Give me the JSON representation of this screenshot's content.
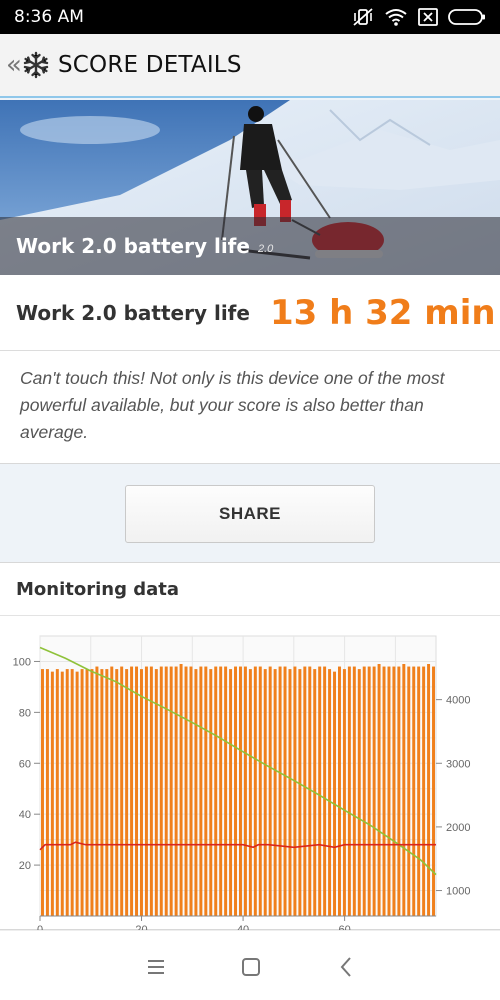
{
  "status_bar": {
    "time": "8:36 AM"
  },
  "app_bar": {
    "back_glyph": "«",
    "title": "SCORE DETAILS",
    "logo_icon": "snowflake-icon"
  },
  "hero": {
    "caption": "Work 2.0 battery life",
    "version": "2.0"
  },
  "score": {
    "label": "Work 2.0 battery life",
    "value": "13 h 32 min",
    "value_color": "#f07d1a"
  },
  "description": "Can't touch this! Not only is this device one of the most powerful available, but your score is also better than average.",
  "share_button": "SHARE",
  "monitoring": {
    "title": "Monitoring data"
  },
  "chart_data": {
    "type": "bar",
    "title": "",
    "xlabel": "",
    "left_axis": {
      "ticks": [
        "100",
        "80",
        "60",
        "40",
        "20"
      ],
      "range": [
        0,
        110
      ]
    },
    "right_axis": {
      "ticks": [
        "4000",
        "3000",
        "2000",
        "1000"
      ],
      "range": [
        600,
        5000
      ]
    },
    "x_ticks": [
      "0",
      "20",
      "40",
      "60"
    ],
    "x_tick_label_cut_off": true,
    "x_range": [
      0,
      78
    ],
    "grid": true,
    "series": [
      {
        "kind": "bar",
        "axis": "left",
        "color": "#f0801c",
        "values": [
          97,
          97,
          96,
          97,
          96,
          97,
          97,
          96,
          97,
          97,
          97,
          98,
          97,
          97,
          98,
          97,
          98,
          97,
          98,
          98,
          97,
          98,
          98,
          97,
          98,
          98,
          98,
          98,
          99,
          98,
          98,
          97,
          98,
          98,
          97,
          98,
          98,
          98,
          97,
          98,
          98,
          98,
          97,
          98,
          98,
          97,
          98,
          97,
          98,
          98,
          97,
          98,
          97,
          98,
          98,
          97,
          98,
          98,
          97,
          96,
          98,
          97,
          98,
          98,
          97,
          98,
          98,
          98,
          99,
          98,
          98,
          98,
          98,
          99,
          98,
          98,
          98,
          98,
          99,
          98
        ]
      },
      {
        "kind": "line",
        "axis": "right",
        "color": "#8fc23a",
        "x": [
          0,
          5,
          10,
          15,
          20,
          25,
          30,
          35,
          40,
          45,
          50,
          55,
          60,
          65,
          70,
          75,
          78
        ],
        "values": [
          4820,
          4650,
          4450,
          4280,
          4050,
          3850,
          3640,
          3420,
          3180,
          2950,
          2730,
          2500,
          2260,
          2030,
          1760,
          1480,
          1250
        ]
      },
      {
        "kind": "line",
        "axis": "left",
        "color": "#d9251d",
        "x": [
          0,
          1,
          3,
          6,
          7,
          9,
          12,
          20,
          30,
          40,
          42,
          43,
          45,
          50,
          55,
          58,
          60,
          70,
          78
        ],
        "values": [
          26,
          28,
          28,
          28,
          29,
          28,
          28,
          28,
          28,
          28,
          27,
          28,
          28,
          27,
          28,
          27,
          28,
          28,
          28
        ]
      }
    ]
  },
  "nav_bar": {
    "menu_icon": "menu-icon",
    "home_icon": "home-icon",
    "back_icon": "back-icon"
  }
}
